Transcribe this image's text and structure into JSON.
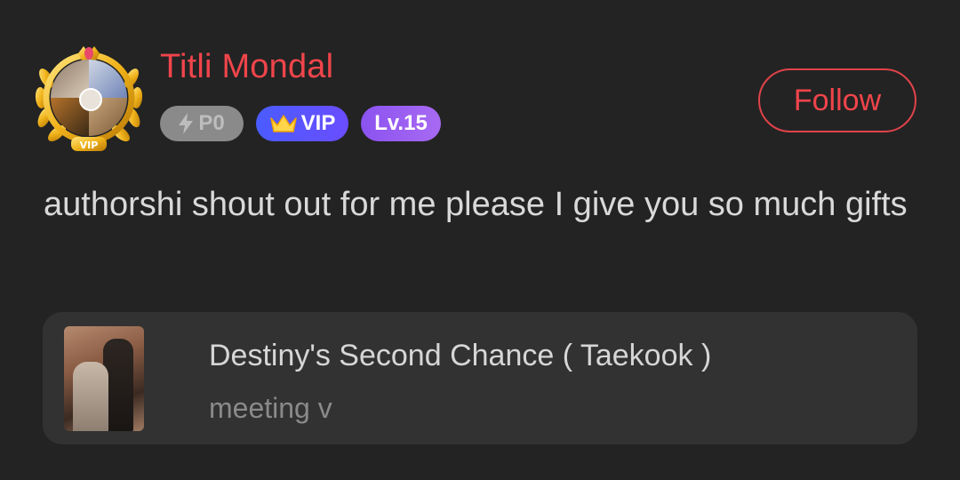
{
  "user": {
    "name": "Titli Mondal",
    "avatar_icon": "avatar-with-gold-laurel-frame",
    "frame_label": "VIP"
  },
  "badges": {
    "p_level": "P0",
    "vip": "VIP",
    "level": "Lv.15"
  },
  "follow_label": "Follow",
  "comment": "authorshi shout out for me please I give you so much gifts",
  "book": {
    "title": "Destiny's Second Chance ( Taekook )",
    "chapter": "meeting v"
  },
  "colors": {
    "background": "#232323",
    "username": "#f0454b",
    "follow_border": "#e0434a",
    "card": "#323232",
    "vip_badge": "#5b56ff",
    "level_badge": "#9a5ff1",
    "p_badge": "#8a8a8a"
  }
}
